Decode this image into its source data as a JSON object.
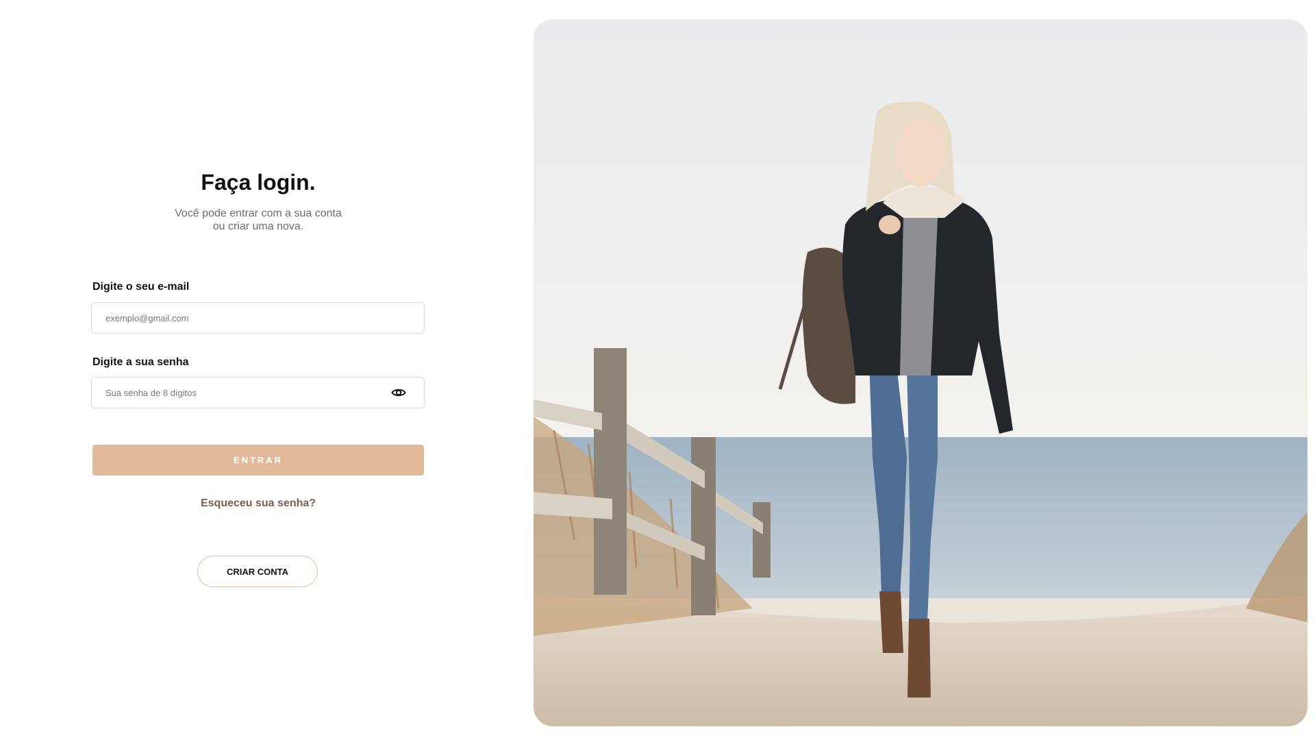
{
  "login": {
    "title": "Faça login.",
    "subtitle_line1": "Você pode entrar com a sua conta",
    "subtitle_line2": "ou criar uma nova.",
    "email": {
      "label": "Digite o seu e-mail",
      "placeholder": "exemplo@gmail.com",
      "value": ""
    },
    "password": {
      "label": "Digite a sua senha",
      "placeholder": "Sua senha de 8 dígitos",
      "value": "",
      "toggle_icon": "eye-icon"
    },
    "submit_label": "ENTRAR",
    "forgot_label": "Esqueceu sua senha?",
    "create_account_label": "CRIAR CONTA"
  },
  "colors": {
    "accent": "#e0b999",
    "link": "#7a5d4f",
    "outline": "#dfc1ae"
  }
}
